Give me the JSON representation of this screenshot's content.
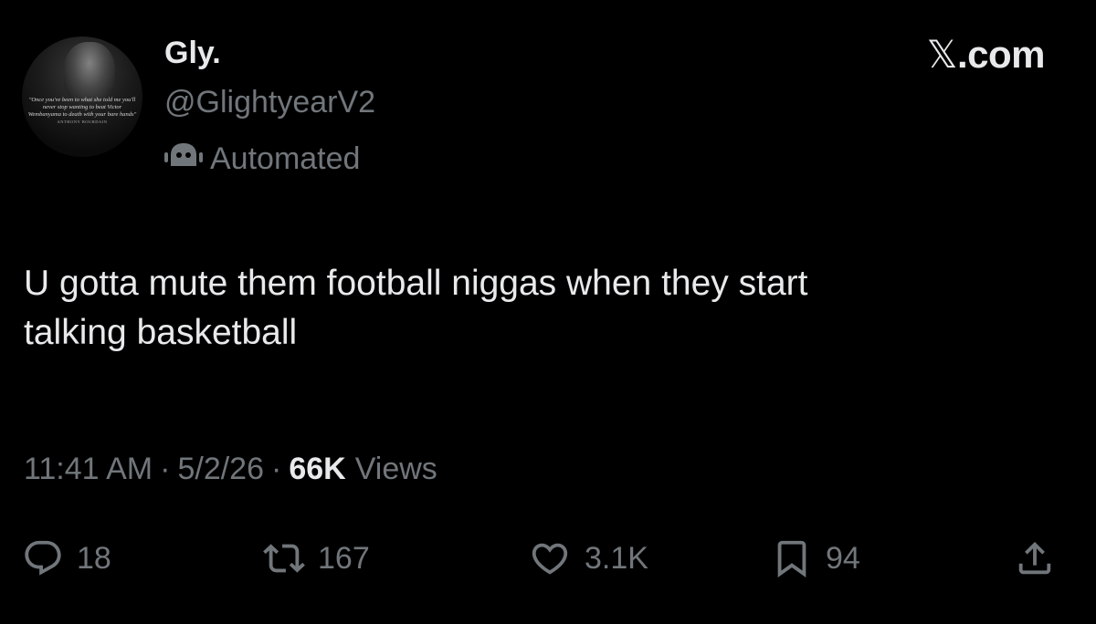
{
  "author": {
    "display_name": "Gly.",
    "handle": "@GlightyearV2",
    "automated_label": "Automated",
    "avatar_quote": "\"Once you've been to what she told me you'll never stop wanting to beat Victor Wembanyama to death with your bare hands\"",
    "avatar_quote_attribution": "ANTHONY BOURDAIN"
  },
  "brand": {
    "label_prefix": "𝕏",
    "label_suffix": ".com"
  },
  "tweet": {
    "text": "U gotta mute them football niggas when they start\ntalking basketball"
  },
  "meta": {
    "time": "11:41 AM",
    "separator": "·",
    "date": "5/2/26",
    "views_count": "66K",
    "views_label": "Views"
  },
  "actions": {
    "replies": {
      "icon": "reply-icon",
      "count": "18"
    },
    "reposts": {
      "icon": "repost-icon",
      "count": "167"
    },
    "likes": {
      "icon": "like-icon",
      "count": "3.1K"
    },
    "bookmarks": {
      "icon": "bookmark-icon",
      "count": "94"
    },
    "share": {
      "icon": "share-icon"
    }
  },
  "colors": {
    "background": "#000000",
    "primary_text": "#e7e9ea",
    "secondary_text": "#71767b"
  }
}
